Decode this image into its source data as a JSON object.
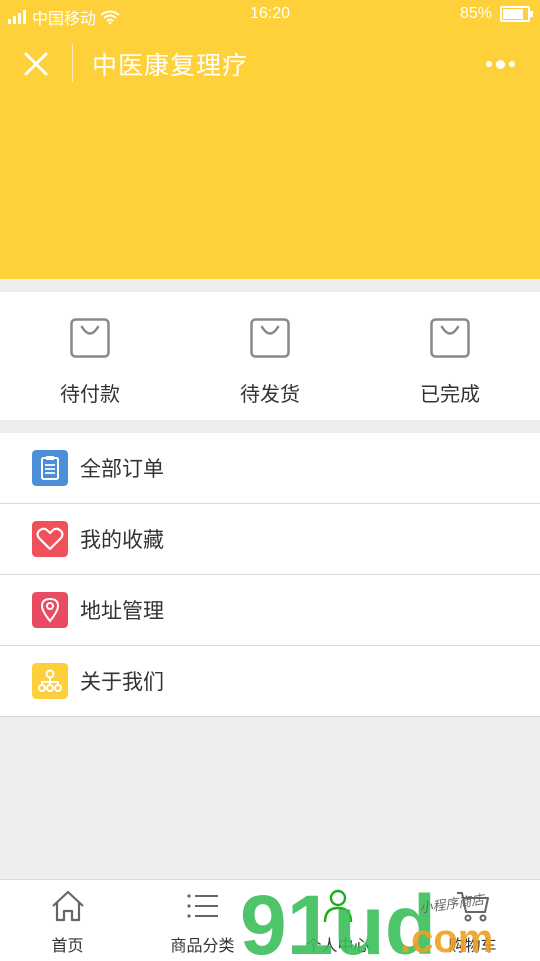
{
  "status_bar": {
    "carrier": "中国移动",
    "time": "16:20",
    "battery": "85%",
    "battery_level": 0.85
  },
  "nav": {
    "title": "中医康复理疗"
  },
  "orders": [
    {
      "label": "待付款"
    },
    {
      "label": "待发货"
    },
    {
      "label": "已完成"
    }
  ],
  "menu": [
    {
      "label": "全部订单",
      "icon": "clipboard-icon",
      "color": "#4a8fd8"
    },
    {
      "label": "我的收藏",
      "icon": "heart-icon",
      "color": "#f0505a"
    },
    {
      "label": "地址管理",
      "icon": "location-pin-icon",
      "color": "#e94b63"
    },
    {
      "label": "关于我们",
      "icon": "org-chart-icon",
      "color": "#fccf3b"
    }
  ],
  "tabbar": [
    {
      "label": "首页",
      "icon": "home-icon"
    },
    {
      "label": "商品分类",
      "icon": "list-icon"
    },
    {
      "label": "个人中心",
      "icon": "person-icon"
    },
    {
      "label": "购物车",
      "icon": "cart-icon"
    }
  ],
  "watermark": {
    "text": "91ud",
    "suffix": ".com",
    "caption": "小程序商店"
  },
  "colors": {
    "header": "#fed13b",
    "accent_green": "#3dbf5b",
    "tab_active": "#1aad19"
  }
}
